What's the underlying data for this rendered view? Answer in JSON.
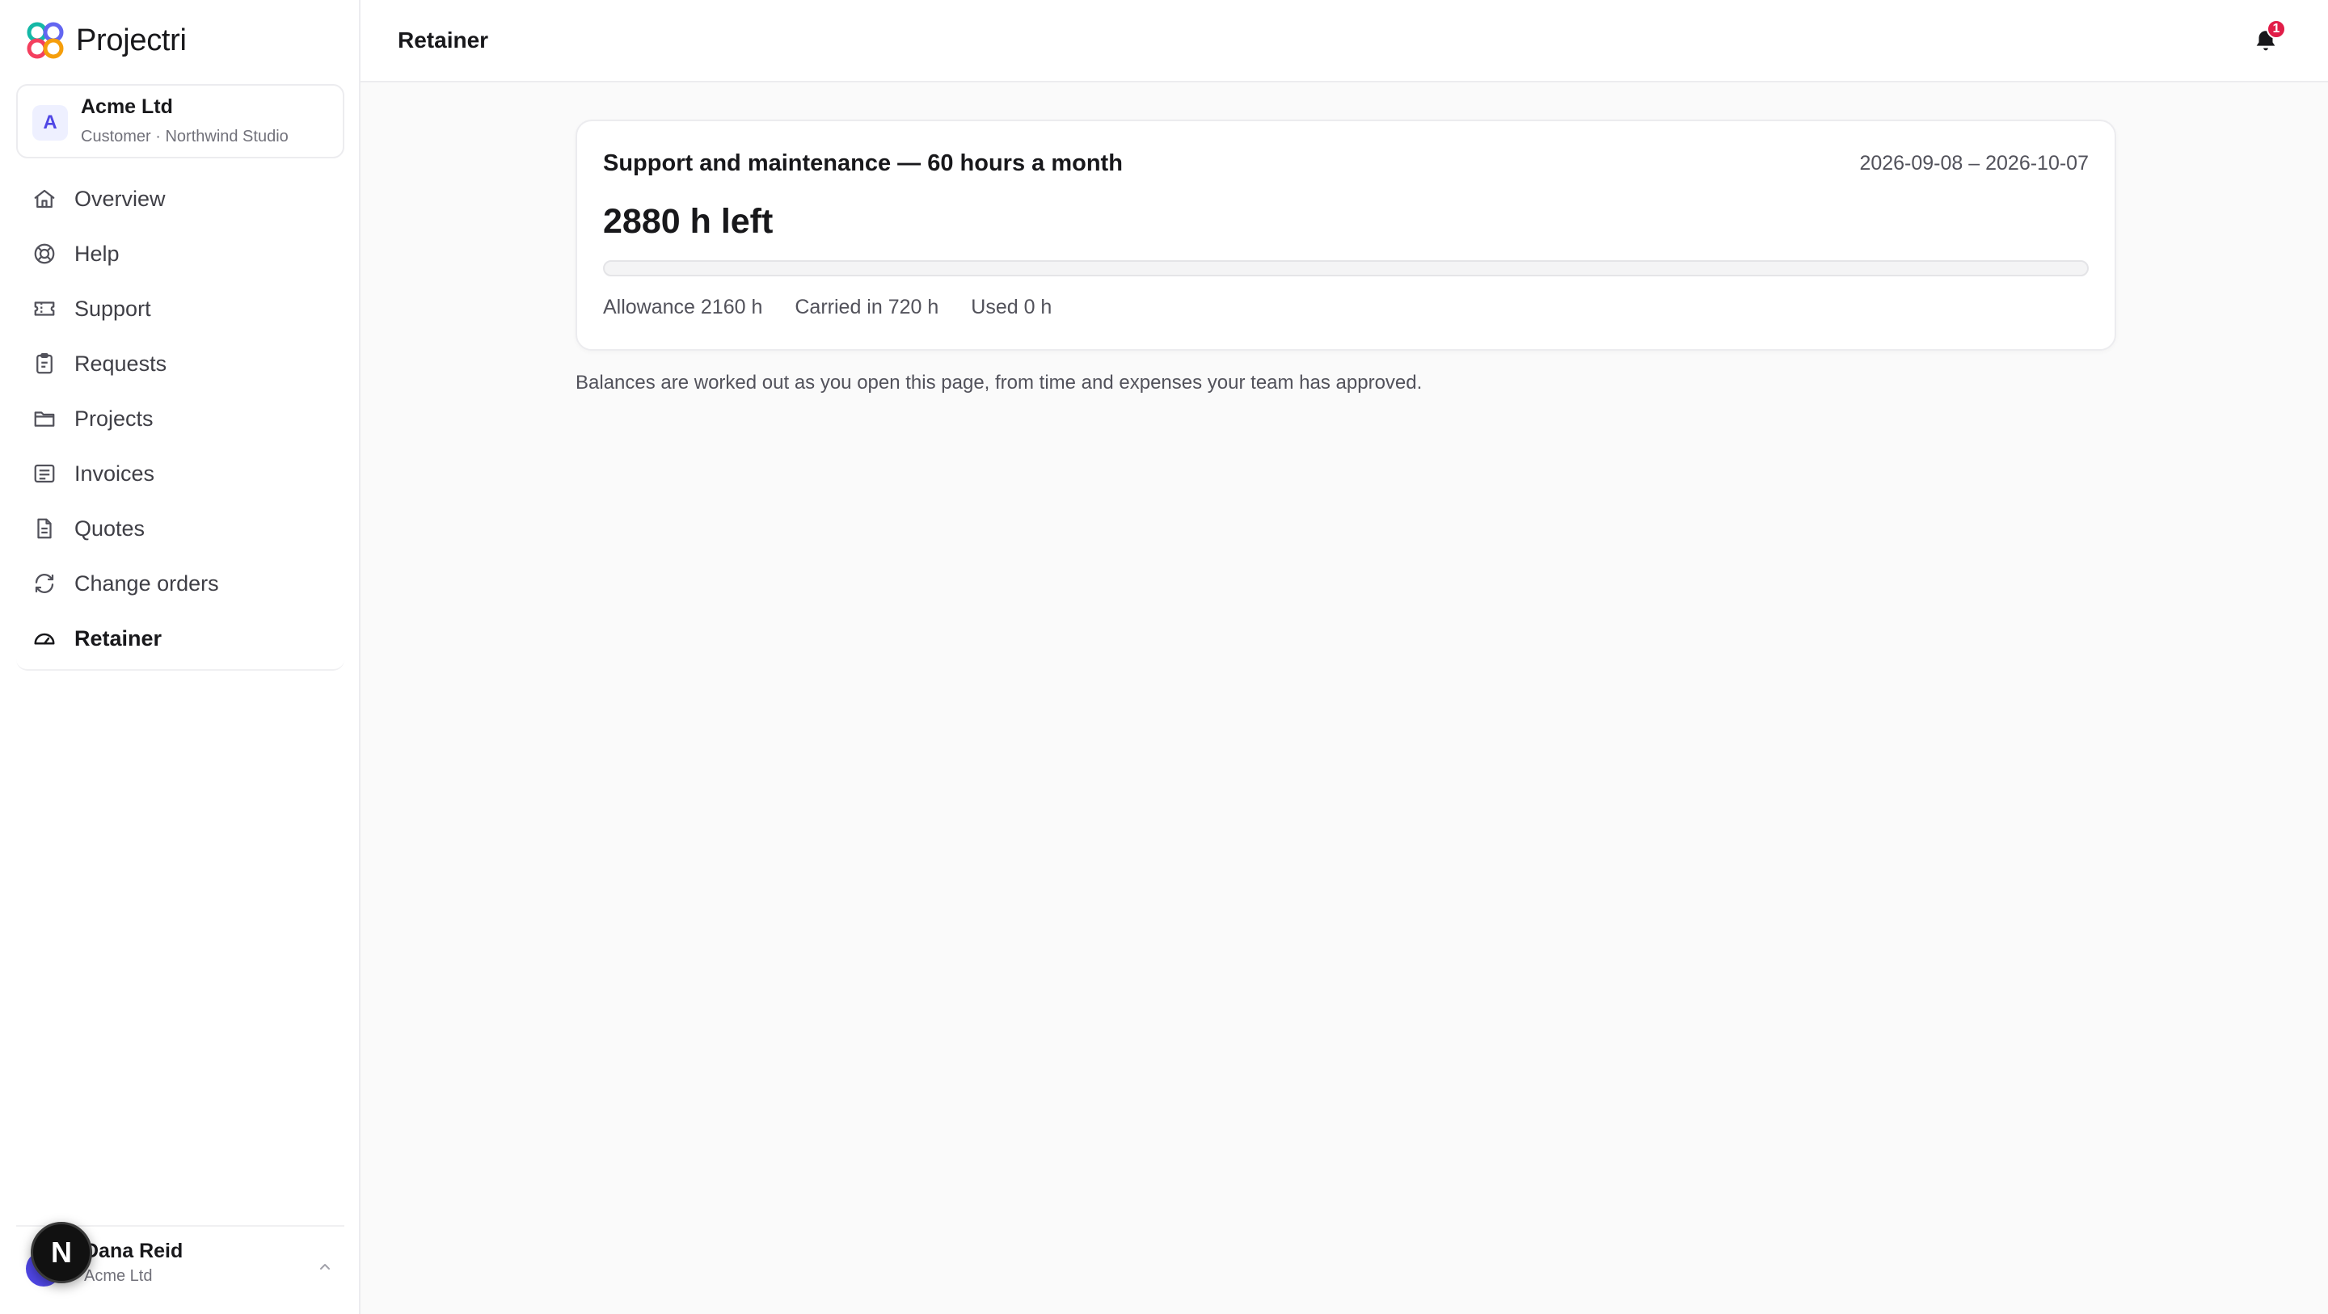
{
  "brand": {
    "name": "Projectri"
  },
  "organization": {
    "avatar_letter": "A",
    "name": "Acme Ltd",
    "subtitle": "Customer · Northwind Studio"
  },
  "sidebar": {
    "items": [
      {
        "label": "Overview",
        "icon": "home-icon",
        "active": false
      },
      {
        "label": "Help",
        "icon": "lifebuoy-icon",
        "active": false
      },
      {
        "label": "Support",
        "icon": "ticket-icon",
        "active": false
      },
      {
        "label": "Requests",
        "icon": "clipboard-icon",
        "active": false
      },
      {
        "label": "Projects",
        "icon": "folder-icon",
        "active": false
      },
      {
        "label": "Invoices",
        "icon": "receipt-icon",
        "active": false
      },
      {
        "label": "Quotes",
        "icon": "document-icon",
        "active": false
      },
      {
        "label": "Change orders",
        "icon": "refresh-icon",
        "active": false
      },
      {
        "label": "Retainer",
        "icon": "gauge-icon",
        "active": true
      }
    ]
  },
  "user": {
    "name": "Dana Reid",
    "organization": "Acme Ltd",
    "dev_badge_letter": "N"
  },
  "header": {
    "title": "Retainer",
    "notification_count": "1"
  },
  "retainer": {
    "title": "Support and maintenance — 60 hours a month",
    "period": "2026-09-08 – 2026-10-07",
    "balance_text": "2880 h left",
    "progress_used_fraction": 0,
    "stats": {
      "allowance": "Allowance 2160 h",
      "carried_in": "Carried in 720 h",
      "used": "Used 0 h"
    }
  },
  "footnote": "Balances are worked out as you open this page, from time and expenses your team has approved.",
  "colors": {
    "accent": "#4f46e5",
    "notification": "#e11d48"
  }
}
